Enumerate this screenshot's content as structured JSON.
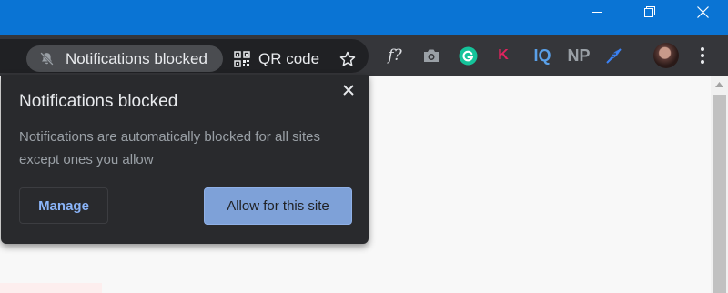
{
  "browser": {
    "permission_chip": {
      "label": "Notifications blocked",
      "icon": "bell-off-icon"
    },
    "qr_button": {
      "label": "QR code",
      "icon": "qr-code-icon"
    },
    "bookmark": {
      "icon": "star-icon"
    },
    "extensions": [
      {
        "name": "f?",
        "icon": "fx-extension-icon"
      },
      {
        "name": "",
        "icon": "camera-extension-icon"
      },
      {
        "name": "",
        "icon": "grammarly-extension-icon",
        "color": "#15c39a"
      },
      {
        "name": "K",
        "icon": "k-extension-icon",
        "color": "#e0245e"
      },
      {
        "name": "IQ",
        "icon": "iq-extension-icon",
        "color": "#5aa0e8"
      },
      {
        "name": "NP",
        "icon": "np-extension-icon"
      },
      {
        "name": "",
        "icon": "feather-extension-icon",
        "color": "#3b82f6"
      }
    ],
    "accent": "#0a74d4"
  },
  "popup": {
    "title": "Notifications blocked",
    "description": "Notifications are automatically blocked for all sites except ones you allow",
    "manage_label": "Manage",
    "allow_label": "Allow for this site"
  }
}
